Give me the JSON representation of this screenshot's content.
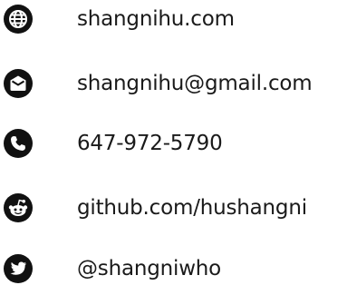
{
  "contacts": [
    {
      "type": "website",
      "icon": "globe-icon",
      "label": "shangnihu.com"
    },
    {
      "type": "email",
      "icon": "envelope-icon",
      "label": "shangnihu@gmail.com"
    },
    {
      "type": "phone",
      "icon": "phone-icon",
      "label": "647-972-5790"
    },
    {
      "type": "github",
      "icon": "reddit-alien-icon",
      "label": "github.com/hushangni"
    },
    {
      "type": "twitter",
      "icon": "twitter-bird-icon",
      "label": "@shangniwho"
    }
  ],
  "colors": {
    "icon": "#111111",
    "text": "#1a1a1a",
    "background": "#ffffff"
  }
}
